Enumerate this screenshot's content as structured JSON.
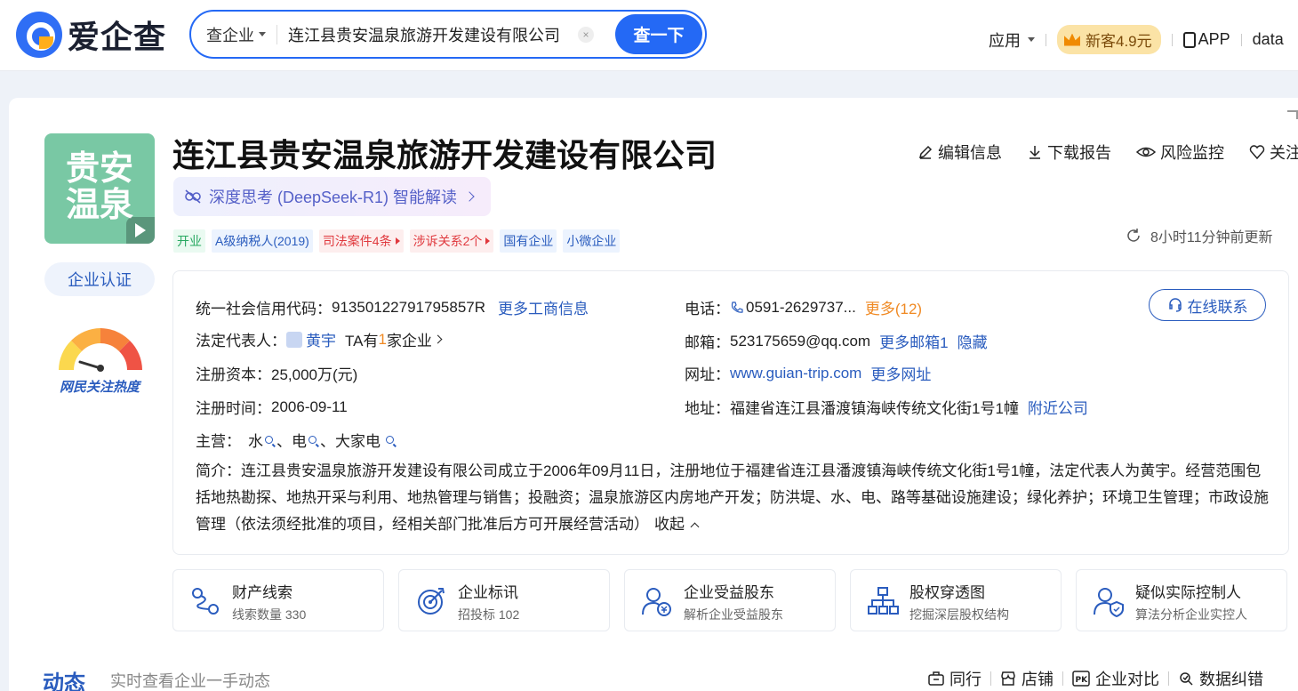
{
  "header": {
    "logo_text": "爱企查",
    "search_type": "查企业",
    "search_value": "连江县贵安温泉旅游开发建设有限公司",
    "search_button": "查一下",
    "nav_apps": "应用",
    "vip_label": "新客4.9元",
    "app_label": "APP",
    "user_label": "data"
  },
  "company": {
    "logo_text_1": "贵安",
    "logo_text_2": "温泉",
    "name": "连江县贵安温泉旅游开发建设有限公司",
    "ai_label": "深度思考 (DeepSeek-R1) 智能解读",
    "cert_label": "企业认证",
    "gauge_label": "网民关注热度",
    "tags": [
      "开业",
      "A级纳税人(2019)",
      "司法案件4条",
      "涉诉关系2个",
      "国有企业",
      "小微企业"
    ],
    "actions": [
      "编辑信息",
      "下载报告",
      "风险监控",
      "关注"
    ],
    "updated": "8小时11分钟前更新"
  },
  "info": {
    "credit_code_label": "统一社会信用代码：",
    "credit_code": "91350122791795857R",
    "more_business": "更多工商信息",
    "legal_rep_label": "法定代表人：",
    "legal_rep": "黄宇",
    "legal_rep_ta": "TA有",
    "legal_rep_count": "1",
    "legal_rep_suffix": "家企业",
    "capital_label": "注册资本：",
    "capital": "25,000万(元)",
    "reg_date_label": "注册时间：",
    "reg_date": "2006-09-11",
    "main_label": "主营：",
    "main_1": "水",
    "main_2": "、电",
    "main_3": "、大家电",
    "phone_label": "电话：",
    "phone": "0591-2629737...",
    "phone_more": "更多(12)",
    "email_label": "邮箱：",
    "email": "523175659@qq.com",
    "email_more": "更多邮箱1",
    "email_hide": "隐藏",
    "web_label": "网址：",
    "website": "www.guian-trip.com",
    "web_more": "更多网址",
    "addr_label": "地址：",
    "address": "福建省连江县潘渡镇海峡传统文化街1号1幢",
    "nearby": "附近公司",
    "online_contact": "在线联系",
    "intro_label": "简介：",
    "intro": "连江县贵安温泉旅游开发建设有限公司成立于2006年09月11日，注册地位于福建省连江县潘渡镇海峡传统文化街1号1幢，法定代表人为黄宇。经营范围包括地热勘探、地热开采与利用、地热管理与销售；投融资；温泉旅游区内房地产开发；防洪堤、水、电、路等基础设施建设；绿化养护；环境卫生管理；市政设施管理（依法须经批准的项目，经相关部门批准后方可开展经营活动）",
    "collapse": "收起"
  },
  "features": [
    {
      "title": "财产线索",
      "sub": "线索数量 330"
    },
    {
      "title": "企业标讯",
      "sub": "招投标 102"
    },
    {
      "title": "企业受益股东",
      "sub": "解析企业受益股东"
    },
    {
      "title": "股权穿透图",
      "sub": "挖掘深层股权结构"
    },
    {
      "title": "疑似实际控制人",
      "sub": "算法分析企业实控人"
    }
  ],
  "bottom": {
    "dynamics": "动态",
    "dynamics_sub": "实时查看企业一手动态",
    "links": [
      "同行",
      "店铺",
      "企业对比",
      "数据纠错"
    ]
  },
  "colors": {
    "brand_blue": "#2469f5",
    "link_blue": "#2a5cbe",
    "logo_green": "#79c8a4",
    "orange": "#f08a24",
    "red": "#e0393e"
  }
}
